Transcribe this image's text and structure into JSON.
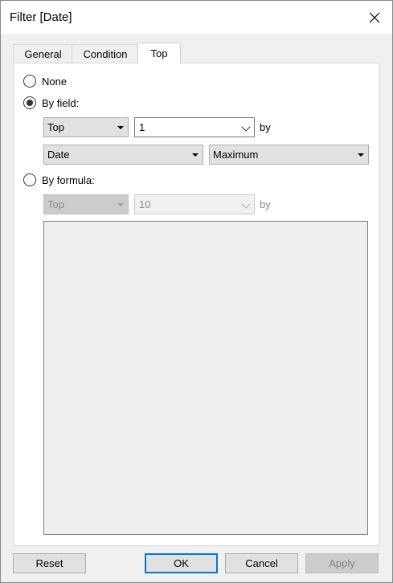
{
  "window": {
    "title": "Filter [Date]"
  },
  "tabs": [
    {
      "label": "General",
      "active": false
    },
    {
      "label": "Condition",
      "active": false
    },
    {
      "label": "Top",
      "active": true
    }
  ],
  "options": {
    "none": {
      "label": "None",
      "checked": false
    },
    "by_field": {
      "label": "By field:",
      "checked": true,
      "direction": "Top",
      "count": "1",
      "by_label": "by",
      "field": "Date",
      "aggregation": "Maximum"
    },
    "by_formula": {
      "label": "By formula:",
      "checked": false,
      "direction": "Top",
      "count": "10",
      "by_label": "by",
      "formula_text": ""
    }
  },
  "buttons": {
    "reset": "Reset",
    "ok": "OK",
    "cancel": "Cancel",
    "apply": "Apply"
  }
}
